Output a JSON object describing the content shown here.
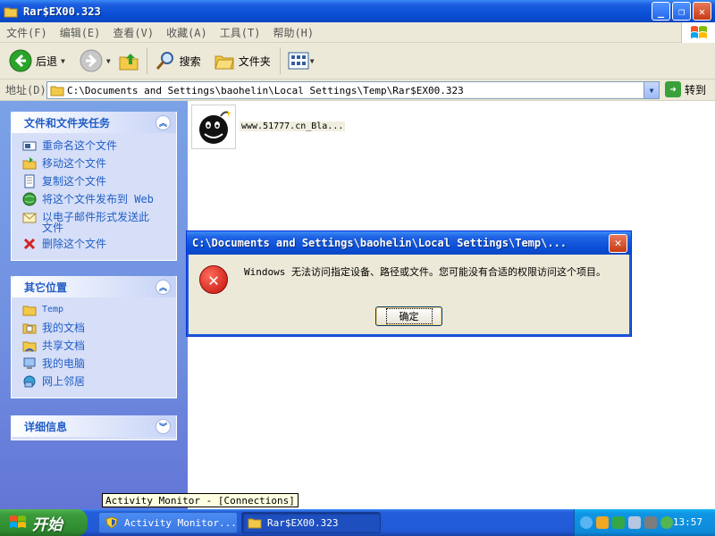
{
  "window": {
    "title": "Rar$EX00.323",
    "min": "_",
    "max": "❐",
    "close": "✕"
  },
  "menu": [
    "文件(F)",
    "编辑(E)",
    "查看(V)",
    "收藏(A)",
    "工具(T)",
    "帮助(H)"
  ],
  "toolbar": {
    "back": "后退",
    "search": "搜索",
    "folders": "文件夹"
  },
  "address": {
    "label": "地址(D)",
    "path": "C:\\Documents and Settings\\baohelin\\Local Settings\\Temp\\Rar$EX00.323",
    "go": "转到"
  },
  "tasks": {
    "title": "文件和文件夹任务",
    "items": [
      "重命名这个文件",
      "移动这个文件",
      "复制这个文件",
      "将这个文件发布到 Web",
      "以电子邮件形式发送此文件",
      "删除这个文件"
    ]
  },
  "places": {
    "title": "其它位置",
    "items": [
      "Temp",
      "我的文档",
      "共享文档",
      "我的电脑",
      "网上邻居"
    ]
  },
  "details": {
    "title": "详细信息"
  },
  "file": {
    "name": "www.51777.cn_Bla..."
  },
  "tooltip": "Activity Monitor - [Connections]",
  "dialog": {
    "title": "C:\\Documents and Settings\\baohelin\\Local Settings\\Temp\\...",
    "message": "Windows 无法访问指定设备、路径或文件。您可能没有合适的权限访问这个项目。",
    "ok": "确定",
    "close": "✕",
    "icon": "✕"
  },
  "taskbar": {
    "start": "开始",
    "tasks": [
      "Activity Monitor...",
      "Rar$EX00.323"
    ],
    "clock": "13:57"
  }
}
